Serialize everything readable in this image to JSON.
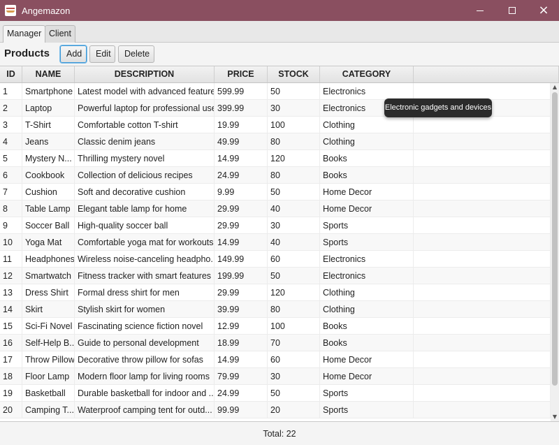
{
  "window": {
    "title": "Angemazon",
    "icon": "app-logo-icon",
    "controls": {
      "minimize": "minimize-icon",
      "maximize": "maximize-icon",
      "close": "×"
    },
    "titlebar_color": "#8a4f60"
  },
  "tabs": [
    {
      "label": "Manager",
      "active": true
    },
    {
      "label": "Client",
      "active": false
    }
  ],
  "toolbar": {
    "title": "Products",
    "add_label": "Add",
    "edit_label": "Edit",
    "delete_label": "Delete"
  },
  "table": {
    "columns": [
      "ID",
      "NAME",
      "DESCRIPTION",
      "PRICE",
      "STOCK",
      "CATEGORY"
    ],
    "rows": [
      {
        "id": "1",
        "name": "Smartphone",
        "description": "Latest model with advanced features",
        "price": "599.99",
        "stock": "50",
        "category": "Electronics"
      },
      {
        "id": "2",
        "name": "Laptop",
        "description": "Powerful laptop for professional use",
        "price": "399.99",
        "stock": "30",
        "category": "Electronics"
      },
      {
        "id": "3",
        "name": "T-Shirt",
        "description": "Comfortable cotton T-shirt",
        "price": "19.99",
        "stock": "100",
        "category": "Clothing"
      },
      {
        "id": "4",
        "name": "Jeans",
        "description": "Classic denim jeans",
        "price": "49.99",
        "stock": "80",
        "category": "Clothing"
      },
      {
        "id": "5",
        "name": "Mystery N...",
        "description": "Thrilling mystery novel",
        "price": "14.99",
        "stock": "120",
        "category": "Books"
      },
      {
        "id": "6",
        "name": "Cookbook",
        "description": "Collection of delicious recipes",
        "price": "24.99",
        "stock": "80",
        "category": "Books"
      },
      {
        "id": "7",
        "name": "Cushion",
        "description": "Soft and decorative cushion",
        "price": "9.99",
        "stock": "50",
        "category": "Home Decor"
      },
      {
        "id": "8",
        "name": "Table Lamp",
        "description": "Elegant table lamp for home",
        "price": "29.99",
        "stock": "40",
        "category": "Home Decor"
      },
      {
        "id": "9",
        "name": "Soccer Ball",
        "description": "High-quality soccer ball",
        "price": "29.99",
        "stock": "30",
        "category": "Sports"
      },
      {
        "id": "10",
        "name": "Yoga Mat",
        "description": "Comfortable yoga mat for workouts",
        "price": "14.99",
        "stock": "40",
        "category": "Sports"
      },
      {
        "id": "11",
        "name": "Headphones",
        "description": "Wireless noise-canceling headpho...",
        "price": "149.99",
        "stock": "60",
        "category": "Electronics"
      },
      {
        "id": "12",
        "name": "Smartwatch",
        "description": "Fitness tracker with smart features",
        "price": "199.99",
        "stock": "50",
        "category": "Electronics"
      },
      {
        "id": "13",
        "name": "Dress Shirt",
        "description": "Formal dress shirt for men",
        "price": "29.99",
        "stock": "120",
        "category": "Clothing"
      },
      {
        "id": "14",
        "name": "Skirt",
        "description": "Stylish skirt for women",
        "price": "39.99",
        "stock": "80",
        "category": "Clothing"
      },
      {
        "id": "15",
        "name": "Sci-Fi Novel",
        "description": "Fascinating science fiction novel",
        "price": "12.99",
        "stock": "100",
        "category": "Books"
      },
      {
        "id": "16",
        "name": "Self-Help B...",
        "description": "Guide to personal development",
        "price": "18.99",
        "stock": "70",
        "category": "Books"
      },
      {
        "id": "17",
        "name": "Throw Pillow",
        "description": "Decorative throw pillow for sofas",
        "price": "14.99",
        "stock": "60",
        "category": "Home Decor"
      },
      {
        "id": "18",
        "name": "Floor Lamp",
        "description": "Modern floor lamp for living rooms",
        "price": "79.99",
        "stock": "30",
        "category": "Home Decor"
      },
      {
        "id": "19",
        "name": "Basketball",
        "description": "Durable basketball for indoor and ...",
        "price": "24.99",
        "stock": "50",
        "category": "Sports"
      },
      {
        "id": "20",
        "name": "Camping T...",
        "description": "Waterproof camping tent for outd...",
        "price": "99.99",
        "stock": "20",
        "category": "Sports"
      }
    ]
  },
  "tooltip": "Electronic gadgets and devices",
  "footer": {
    "total": "Total: 22"
  },
  "accent_color": "#3b97d6"
}
